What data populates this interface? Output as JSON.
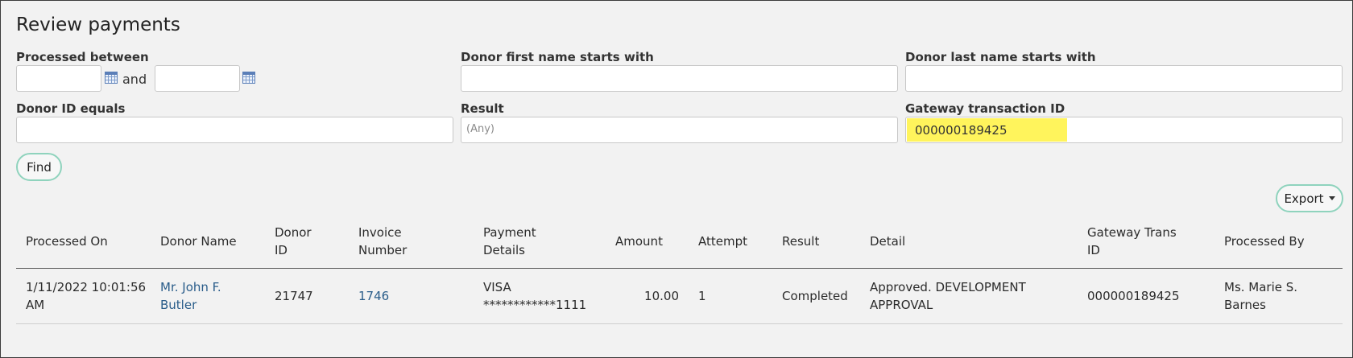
{
  "page": {
    "title": "Review payments"
  },
  "filters": {
    "processed_between_label": "Processed between",
    "and_label": "and",
    "first_name_label": "Donor first name starts with",
    "last_name_label": "Donor last name starts with",
    "donor_id_label": "Donor ID equals",
    "result_label": "Result",
    "result_value": "(Any)",
    "gateway_label": "Gateway transaction ID",
    "gateway_value": "000000189425",
    "highlight_color": "#fff45c"
  },
  "buttons": {
    "find": "Find",
    "export": "Export"
  },
  "table": {
    "headers": {
      "processed_on": "Processed On",
      "donor_name": "Donor Name",
      "donor_id_1": "Donor",
      "donor_id_2": "ID",
      "invoice_1": "Invoice",
      "invoice_2": "Number",
      "payment_1": "Payment",
      "payment_2": "Details",
      "amount": "Amount",
      "attempt": "Attempt",
      "result": "Result",
      "detail": "Detail",
      "gateway_1": "Gateway Trans",
      "gateway_2": "ID",
      "processed_by": "Processed By"
    },
    "rows": [
      {
        "processed_on_1": "1/11/2022 10:01:56",
        "processed_on_2": "AM",
        "donor_name_1": "Mr. John F.",
        "donor_name_2": "Butler",
        "donor_id": "21747",
        "invoice": "1746",
        "payment_1": "VISA",
        "payment_2": "************1111",
        "amount": "10.00",
        "attempt": "1",
        "result": "Completed",
        "detail_1": "Approved. DEVELOPMENT",
        "detail_2": "APPROVAL",
        "gateway": "000000189425",
        "processed_by_1": "Ms. Marie S.",
        "processed_by_2": "Barnes"
      }
    ]
  },
  "icons": {
    "calendar": "calendar-icon",
    "caret": "chevron-down-icon"
  },
  "colors": {
    "link": "#2a5d8a",
    "button_border": "#8fd3bd",
    "background": "#f2f2f2"
  }
}
